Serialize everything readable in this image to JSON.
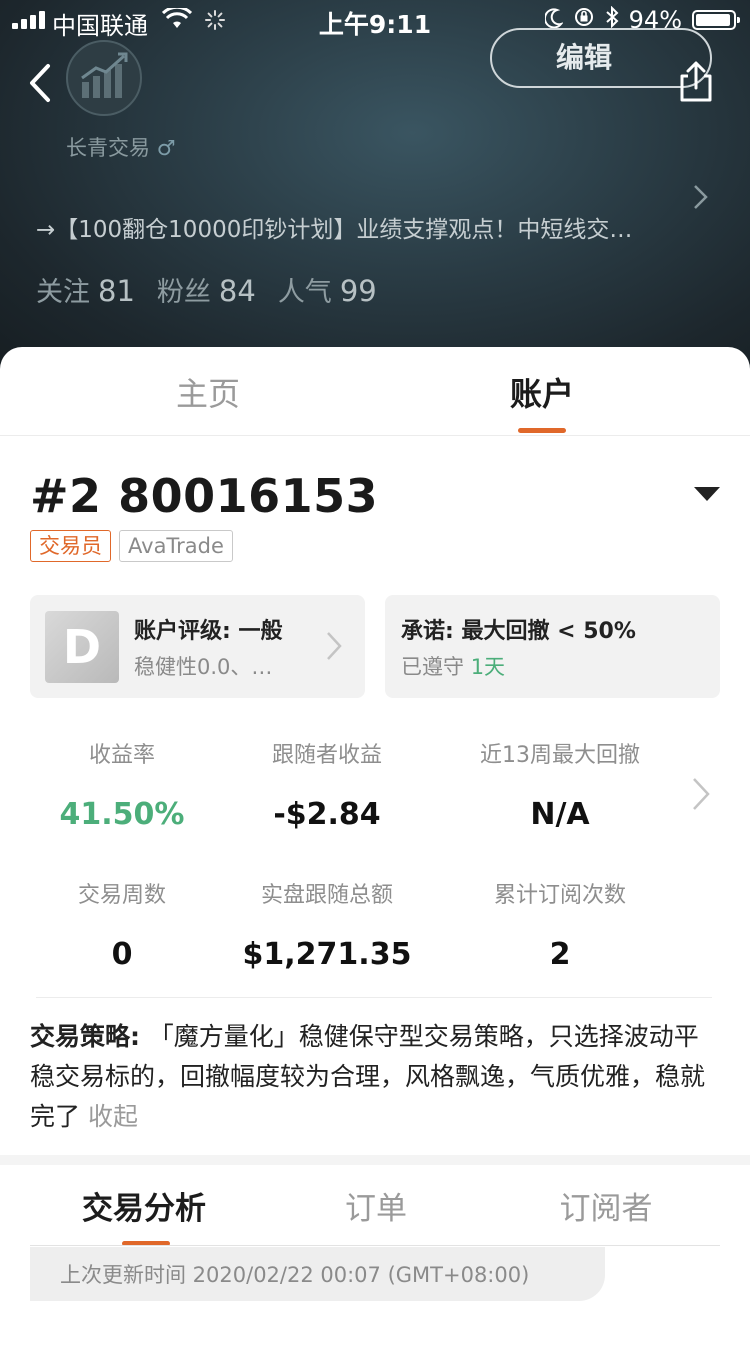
{
  "status_bar": {
    "carrier": "中国联通",
    "time": "上午9:11",
    "battery": "94%",
    "battery_level": 0.94
  },
  "profile": {
    "name": "长青交易",
    "gender_symbol": "♂",
    "edit_label": "编辑",
    "bio": "→【100翻仓10000印钞计划】业绩支撑观点！中短线交…",
    "stats": {
      "follow_label": "关注",
      "follow_value": "81",
      "fans_label": "粉丝",
      "fans_value": "84",
      "popularity_label": "人气",
      "popularity_value": "99"
    }
  },
  "tabs": {
    "home": "主页",
    "account": "账户"
  },
  "account": {
    "number": "#2 80016153",
    "badge_role": "交易员",
    "badge_broker": "AvaTrade",
    "grade_letter": "D",
    "rating_title": "账户评级: 一般",
    "rating_sub": "稳健性0.0、…",
    "promise_title": "承诺: 最大回撤 < 50%",
    "promise_status": "已遵守",
    "promise_days": "1天"
  },
  "metrics": {
    "return_label": "收益率",
    "return_value": "41.50%",
    "follower_profit_label": "跟随者收益",
    "follower_profit_value": "-$2.84",
    "drawdown_label": "近13周最大回撤",
    "drawdown_value": "N/A",
    "weeks_label": "交易周数",
    "weeks_value": "0",
    "live_total_label": "实盘跟随总额",
    "live_total_value": "$1,271.35",
    "subs_label": "累计订阅次数",
    "subs_value": "2"
  },
  "strategy": {
    "label": "交易策略: ",
    "text": "「魔方量化」稳健保守型交易策略，只选择波动平稳交易标的，回撤幅度较为合理，风格飘逸，气质优雅，稳就完了",
    "collapse": "收起"
  },
  "bottom_tabs": {
    "analysis": "交易分析",
    "orders": "订单",
    "subscribers": "订阅者"
  },
  "last_update": "上次更新时间 2020/02/22 00:07 (GMT+08:00)",
  "colors": {
    "accent": "#e0682a",
    "positive": "#4cae7a"
  }
}
